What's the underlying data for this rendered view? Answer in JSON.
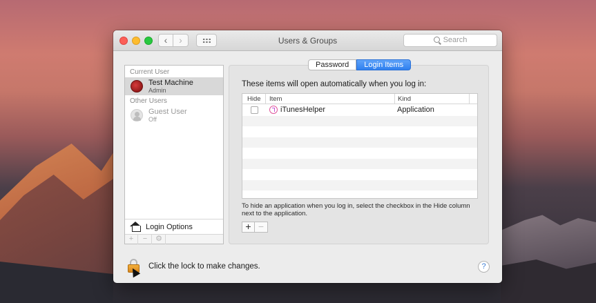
{
  "window": {
    "title": "Users & Groups"
  },
  "search": {
    "placeholder": "Search"
  },
  "sidebar": {
    "current_user_header": "Current User",
    "current_user": {
      "name": "Test Machine",
      "role": "Admin"
    },
    "other_users_header": "Other Users",
    "other_users": [
      {
        "name": "Guest User",
        "status": "Off"
      }
    ],
    "login_options_label": "Login Options"
  },
  "tabs": [
    {
      "label": "Password",
      "selected": false
    },
    {
      "label": "Login Items",
      "selected": true
    }
  ],
  "pane": {
    "title": "These items will open automatically when you log in:",
    "columns": [
      "Hide",
      "Item",
      "Kind"
    ],
    "rows": [
      {
        "hide": false,
        "item": "iTunesHelper",
        "kind": "Application",
        "icon": "itunes-icon"
      }
    ],
    "hint": "To hide an application when you log in, select the checkbox in the Hide column next to the application.",
    "add_label": "+",
    "remove_label": "−"
  },
  "footer": {
    "lock_text": "Click the lock to make changes.",
    "help_label": "?"
  },
  "colors": {
    "accent": "#2f80ef",
    "avatar": "#b51f1f"
  }
}
